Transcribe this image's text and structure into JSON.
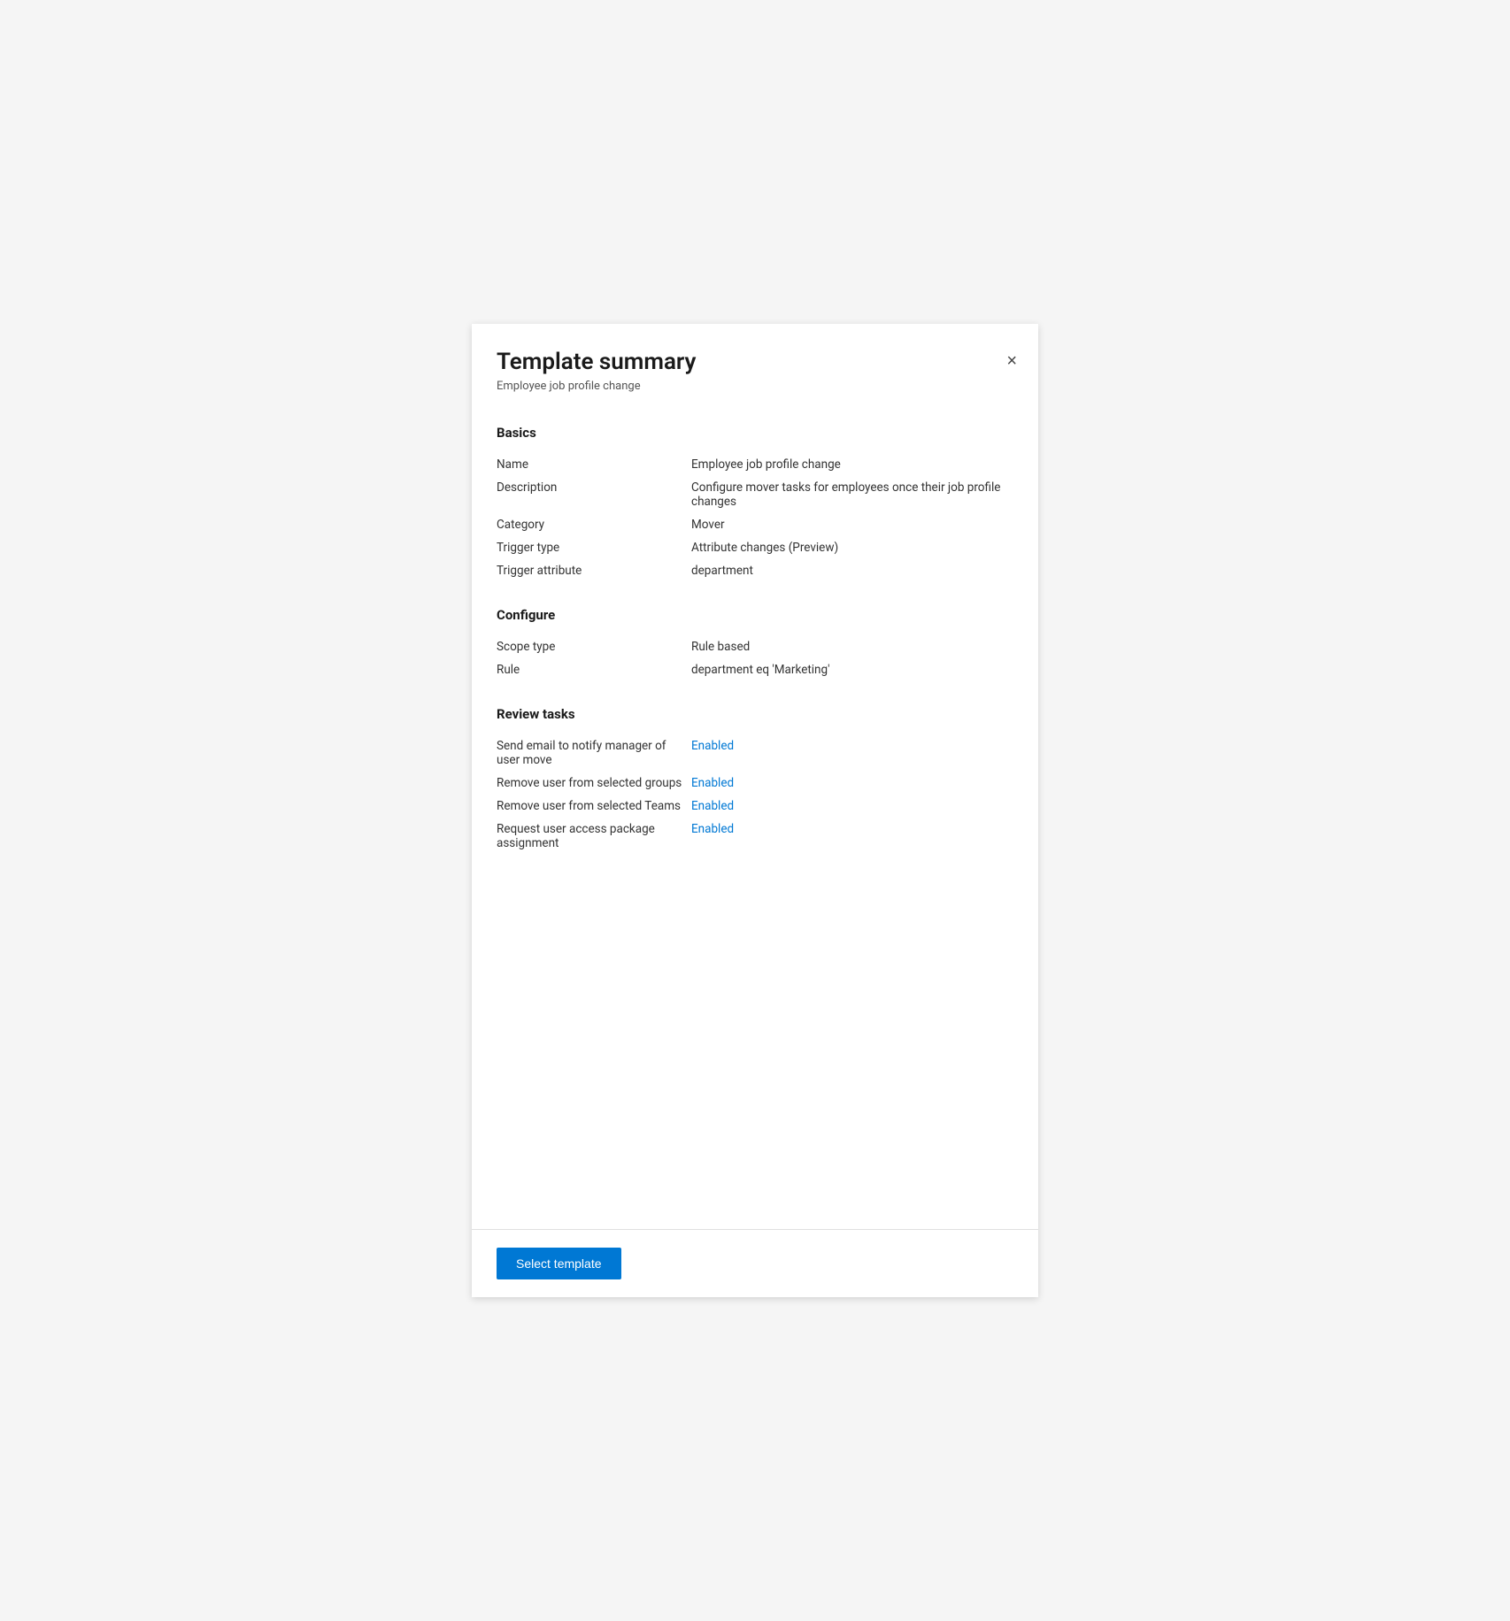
{
  "panel": {
    "title": "Template summary",
    "subtitle": "Employee job profile change",
    "close_icon": "×"
  },
  "basics": {
    "heading": "Basics",
    "rows": [
      {
        "label": "Name",
        "value": "Employee job profile change"
      },
      {
        "label": "Description",
        "value": "Configure mover tasks for employees once their job profile changes"
      },
      {
        "label": "Category",
        "value": "Mover"
      },
      {
        "label": "Trigger type",
        "value": "Attribute changes (Preview)"
      },
      {
        "label": "Trigger attribute",
        "value": "department"
      }
    ]
  },
  "configure": {
    "heading": "Configure",
    "rows": [
      {
        "label": "Scope type",
        "value": "Rule based"
      },
      {
        "label": "Rule",
        "value": "department eq 'Marketing'"
      }
    ]
  },
  "review_tasks": {
    "heading": "Review tasks",
    "rows": [
      {
        "label": "Send email to notify manager of user move",
        "value": "Enabled"
      },
      {
        "label": "Remove user from selected groups",
        "value": "Enabled"
      },
      {
        "label": "Remove user from selected Teams",
        "value": "Enabled"
      },
      {
        "label": "Request user access package assignment",
        "value": "Enabled"
      }
    ]
  },
  "footer": {
    "button_label": "Select template"
  }
}
